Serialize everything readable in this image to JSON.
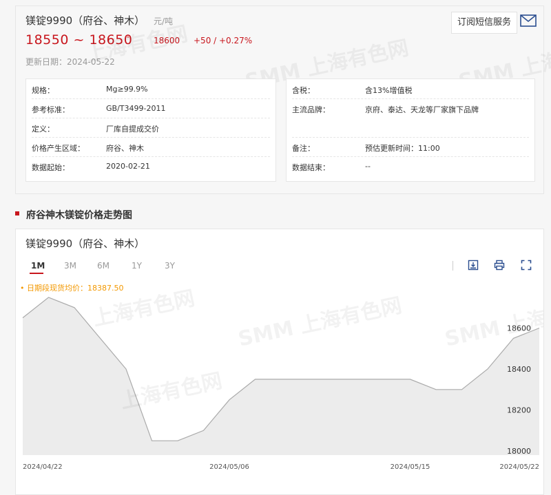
{
  "header": {
    "title": "镁锭9990（府谷、神木）",
    "unit": "元/吨",
    "price_range": "18550 ~ 18650",
    "avg_price": "18600",
    "change": "+50 / +0.27%",
    "update_label": "更新日期：2024-05-22",
    "subscribe_label": "订阅短信服务"
  },
  "specs_left": [
    {
      "key": "规格：",
      "value": "Mg≥99.9%"
    },
    {
      "key": "参考标准：",
      "value": "GB/T3499-2011"
    },
    {
      "key": "定义：",
      "value": "厂库自提成交价"
    },
    {
      "key": "价格产生区域：",
      "value": "府谷、神木"
    },
    {
      "key": "数据起始：",
      "value": "2020-02-21"
    }
  ],
  "specs_right": [
    {
      "key": "含税：",
      "value": "含13%增值税"
    },
    {
      "key": "主流品牌：",
      "value": "京府、泰达、天龙等厂家旗下品牌"
    },
    {
      "key": "备注：",
      "value": "预估更新时间：11:00"
    },
    {
      "key": "数据结束：",
      "value": "--"
    }
  ],
  "section": {
    "title": "府谷神木镁锭价格走势图"
  },
  "chart_panel": {
    "title": "镁锭9990（府谷、神木）",
    "tabs": [
      "1M",
      "3M",
      "6M",
      "1Y",
      "3Y"
    ],
    "active_tab": "1M",
    "legend": "• 日期段现货均价：18387.50"
  },
  "watermark": {
    "brand": "SMM",
    "cn": "上海有色网"
  },
  "colors": {
    "accent": "#c8161d",
    "legend": "#f39800",
    "line": "#aaaaaa",
    "area": "#ececec"
  },
  "icons": [
    "mail-icon",
    "download-image-icon",
    "print-icon",
    "fullscreen-icon",
    "up-arrow-icon"
  ],
  "chart_data": {
    "type": "area",
    "x": [
      "2024-04-22",
      "2024-04-23",
      "2024-04-24",
      "2024-04-25",
      "2024-04-26",
      "2024-04-28",
      "2024-04-29",
      "2024-04-30",
      "2024-05-06",
      "2024-05-07",
      "2024-05-08",
      "2024-05-09",
      "2024-05-10",
      "2024-05-13",
      "2024-05-14",
      "2024-05-15",
      "2024-05-16",
      "2024-05-17",
      "2024-05-20",
      "2024-05-21",
      "2024-05-22"
    ],
    "values": [
      18650,
      18750,
      18700,
      18550,
      18400,
      18050,
      18050,
      18100,
      18250,
      18350,
      18350,
      18350,
      18350,
      18350,
      18350,
      18350,
      18300,
      18300,
      18400,
      18550,
      18600
    ],
    "x_tick_labels": [
      {
        "label": "2024/04/22",
        "index": 0
      },
      {
        "label": "2024/05/06",
        "index": 8
      },
      {
        "label": "2024/05/15",
        "index": 15
      },
      {
        "label": "2024/05/22",
        "index": 20
      }
    ],
    "y_ticks": [
      18000,
      18200,
      18400,
      18600
    ],
    "ylim": [
      17980,
      18800
    ],
    "grid": false,
    "axis_position": "right"
  }
}
